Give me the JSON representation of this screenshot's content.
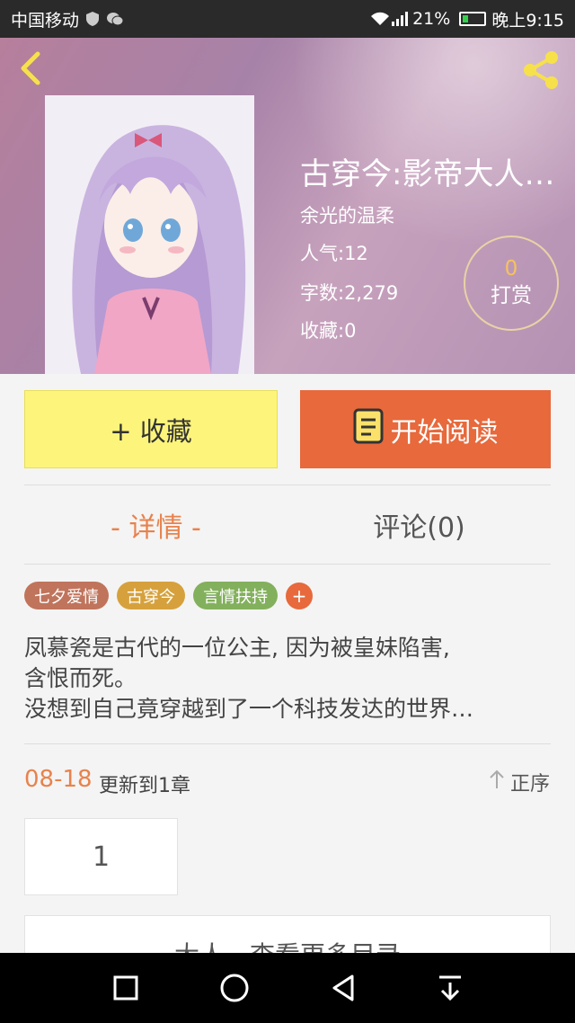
{
  "status_bar": {
    "carrier": "中国移动",
    "battery": "21%",
    "time": "晚上9:15"
  },
  "book": {
    "title": "古穿今:影帝大人…",
    "author": "余光的温柔",
    "popularity": "人气:12",
    "word_count": "字数:2,279",
    "favorites": "收藏:0",
    "tip_count": "0",
    "tip_label": "打赏"
  },
  "actions": {
    "favorite_label": "+ 收藏",
    "read_label": "开始阅读"
  },
  "tabs": {
    "detail": "- 详情 -",
    "comments": "评论(0)"
  },
  "tags": [
    {
      "label": "七夕爱情",
      "color": "#c0745c"
    },
    {
      "label": "古穿今",
      "color": "#d6a13c"
    },
    {
      "label": "言情扶持",
      "color": "#83b05c"
    }
  ],
  "tag_add": "+",
  "synopsis": {
    "line1": "凤慕瓷是古代的一位公主, 因为被皇妹陷害,",
    "line2": "含恨而死。",
    "line3": "没想到自己竟穿越到了一个科技发达的世界…"
  },
  "update": {
    "date": "08-18",
    "text": "更新到1章",
    "order_label": "正序"
  },
  "chapters": [
    "1"
  ],
  "more_catalog": "大人，查看更多目录",
  "colors": {
    "accent": "#e7693c",
    "favorite_button": "#fdf57b",
    "tab_active": "#e8824c"
  }
}
